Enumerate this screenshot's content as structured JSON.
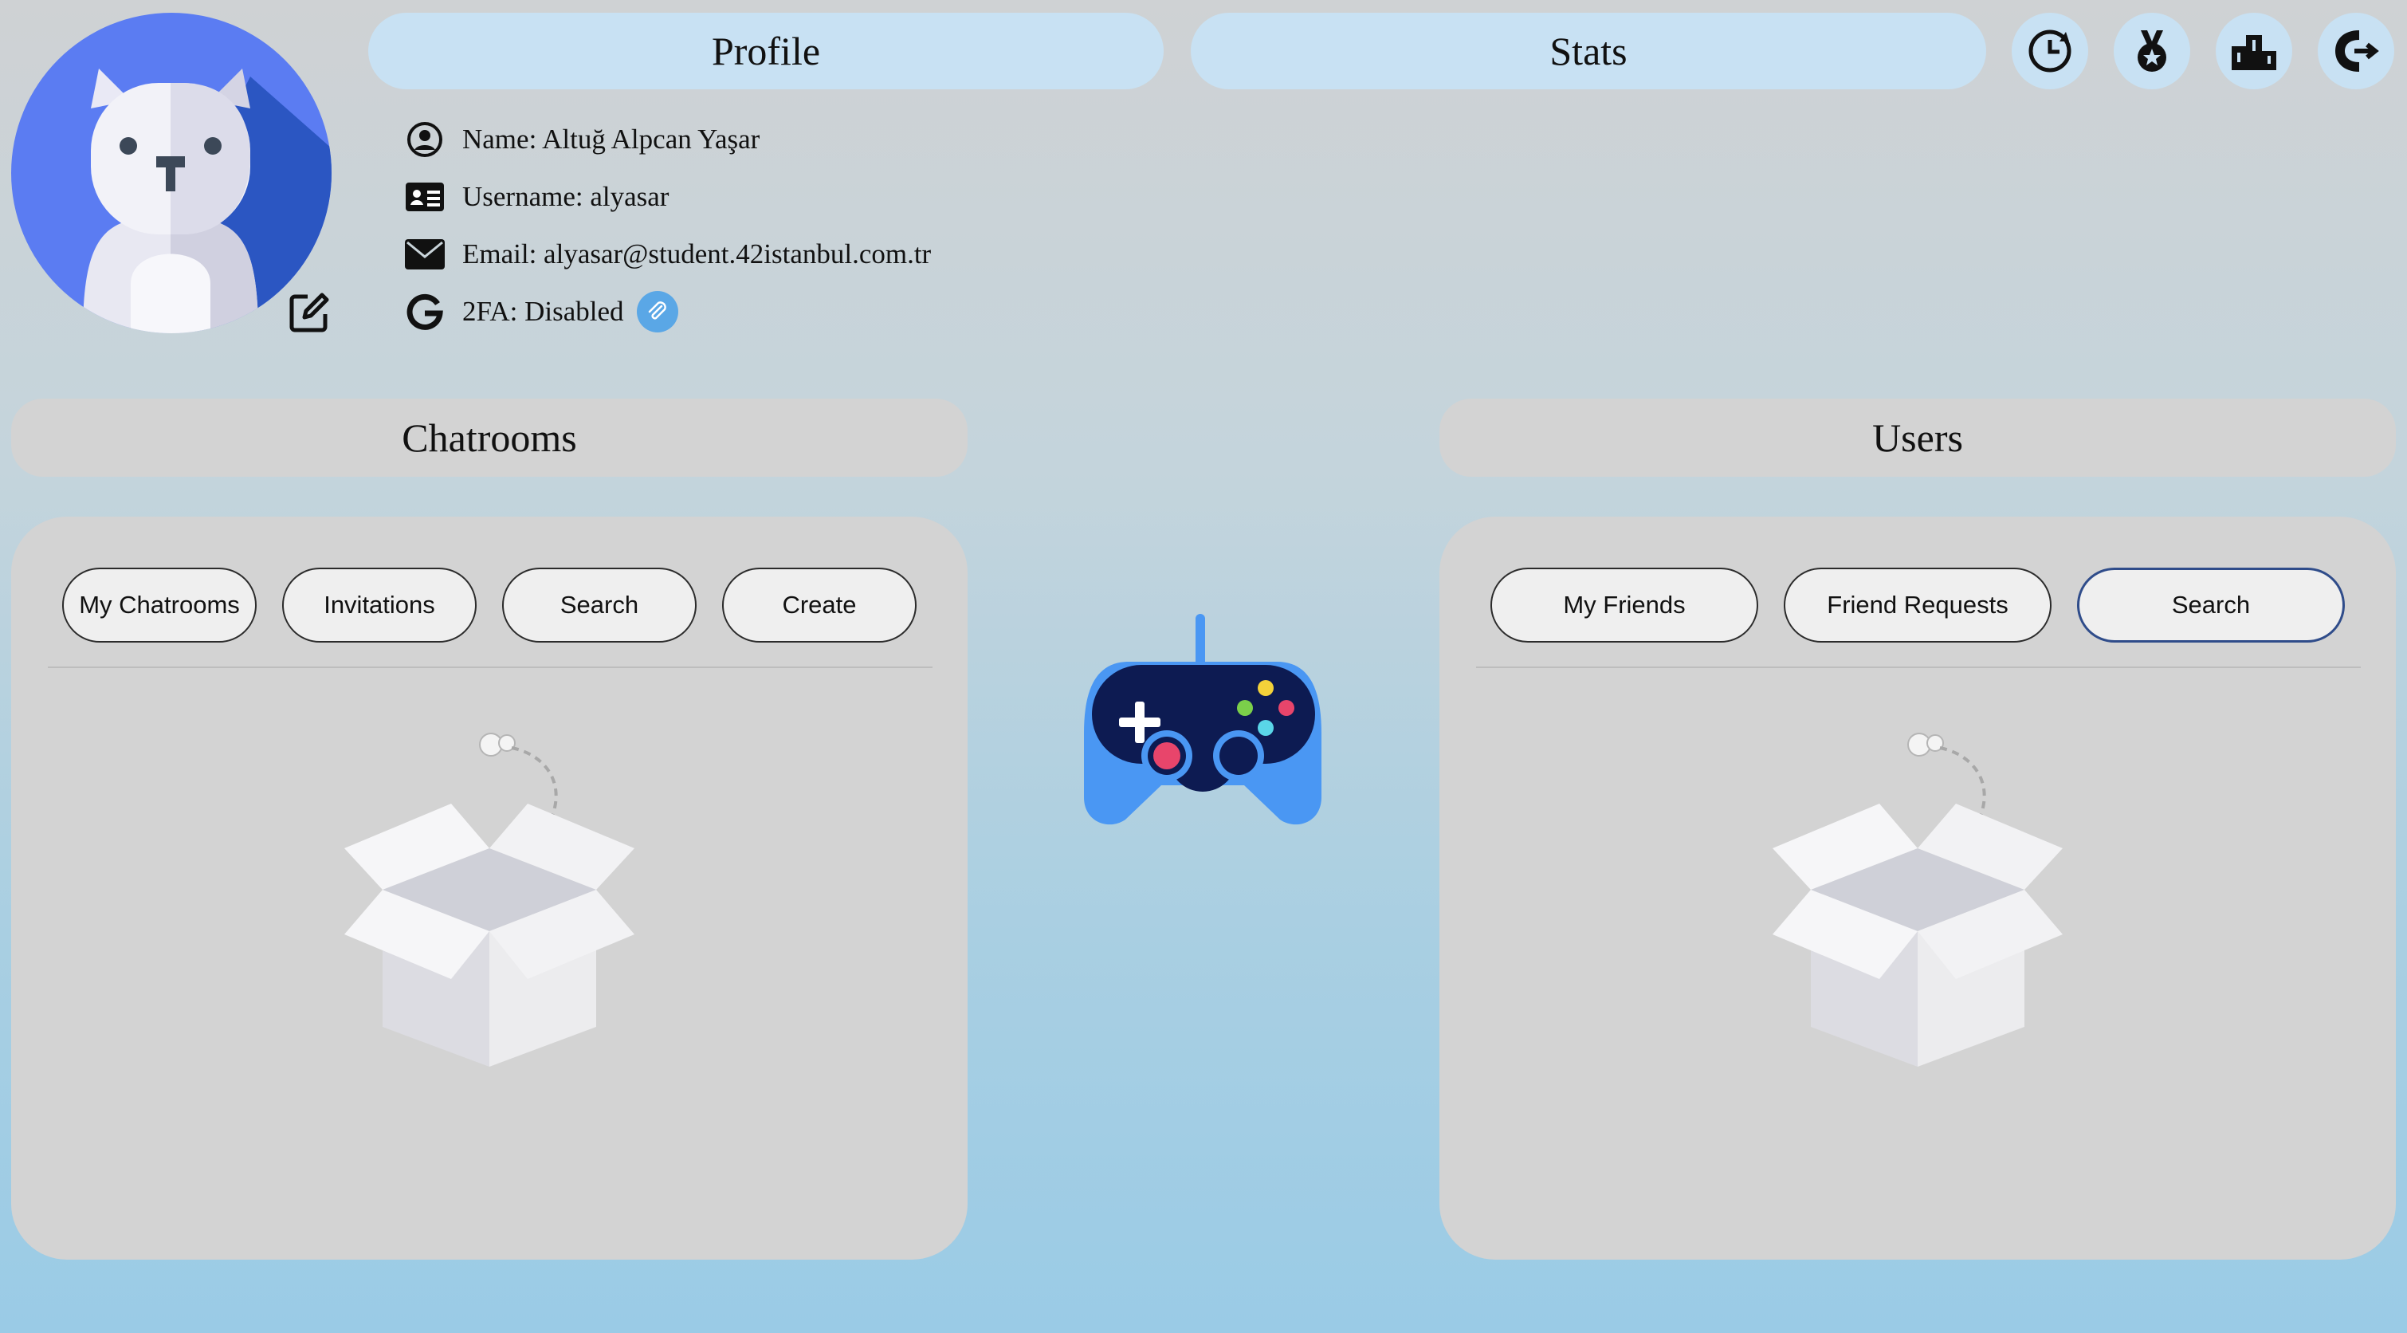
{
  "header": {
    "tabs": [
      {
        "label": "Profile"
      },
      {
        "label": "Stats"
      }
    ],
    "icons": [
      "history-icon",
      "achievements-medal-icon",
      "leaderboard-podium-icon",
      "logout-icon"
    ]
  },
  "profile": {
    "name": "Name: Altuğ Alpcan Yaşar",
    "username": "Username: alyasar",
    "email": "Email: alyasar@student.42istanbul.com.tr",
    "twofa": "2FA: Disabled"
  },
  "chatrooms": {
    "title": "Chatrooms",
    "buttons": [
      "My Chatrooms",
      "Invitations",
      "Search",
      "Create"
    ]
  },
  "users": {
    "title": "Users",
    "buttons": [
      "My Friends",
      "Friend Requests",
      "Search"
    ],
    "active": "Search"
  },
  "colors": {
    "tab_bg": "#c8e1f3",
    "panel_bg": "#d3d3d3",
    "avatar_blue": "#5b7cf2",
    "gamepad_blue": "#4a97f3",
    "gamepad_dark": "#0d1b52"
  }
}
